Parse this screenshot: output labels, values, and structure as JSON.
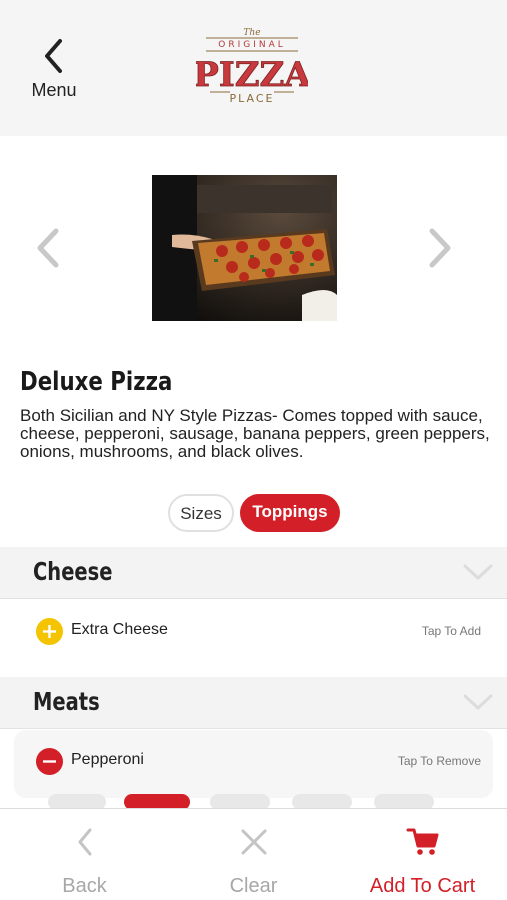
{
  "header": {
    "menu_label": "Menu",
    "logo": {
      "line1": "The",
      "line2": "ORIGINAL",
      "line3": "PIZZA",
      "line4": "PLACE"
    }
  },
  "product": {
    "title": "Deluxe Pizza",
    "description": "Both Sicilian and NY Style Pizzas- Comes topped with sauce, cheese, pepperoni, sausage, banana peppers, green peppers, onions, mushrooms, and black olives."
  },
  "tabs": [
    {
      "label": "Sizes",
      "active": false
    },
    {
      "label": "Toppings",
      "active": true
    }
  ],
  "sections": [
    {
      "title": "Cheese",
      "items": [
        {
          "name": "Extra Cheese",
          "action": "Tap To Add",
          "state": "add"
        }
      ]
    },
    {
      "title": "Meats",
      "items": [
        {
          "name": "Pepperoni",
          "action": "Tap To Remove",
          "state": "remove"
        }
      ]
    }
  ],
  "bottom_bar": {
    "back_label": "Back",
    "clear_label": "Clear",
    "cart_label": "Add To Cart"
  },
  "colors": {
    "accent": "#d32028",
    "add": "#f5c400",
    "muted": "#a7a7a7"
  }
}
